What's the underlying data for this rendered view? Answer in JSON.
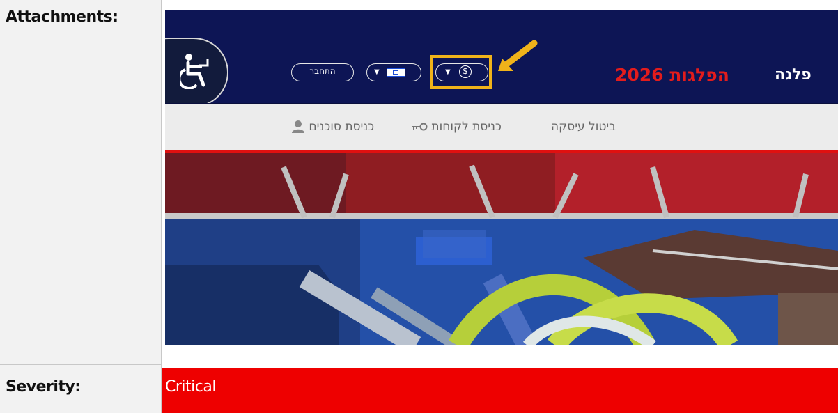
{
  "labels": {
    "attachments": "Attachments:",
    "severity": "Severity:"
  },
  "severity": {
    "value": "Critical",
    "color": "#ee0000"
  },
  "screenshot": {
    "header": {
      "brand_title": "פלגה",
      "brand_year": "הפלגות 2026",
      "login_label": "התחבר",
      "language_icon": "israel-flag-icon",
      "currency_icon": "dollar-icon",
      "accessibility_icon": "wheelchair-icon"
    },
    "nav": {
      "cancel": "ביטול עיסקה",
      "clients": "כניסת לקוחות",
      "agents": "כניסת סוכנים"
    },
    "colors": {
      "header_bg": "#0d1555",
      "accent_red": "#e31c1c",
      "highlight": "#f0b31a"
    }
  }
}
